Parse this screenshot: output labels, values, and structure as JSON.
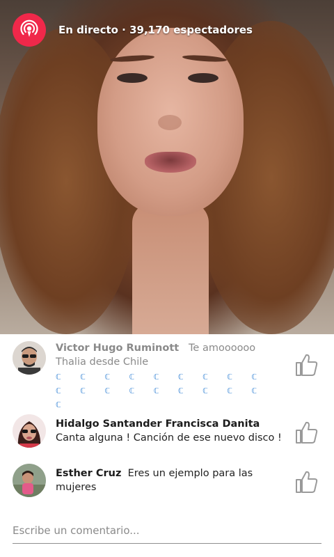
{
  "live": {
    "status_label": "En directo · 39,170 espectadores",
    "badge_color": "#f0284a"
  },
  "comments": [
    {
      "author": "Victor Hugo Ruminott",
      "message": "Te amoooooo Thalia desde Chile",
      "extra": "ℂ ℂ ℂ ℂ ℂ ℂ ℂ ℂ ℂ ℂ ℂ ℂ ℂ ℂ ℂ ℂ ℂ ℂ ℂ",
      "style": "muted",
      "avatar_icon": "avatar-man-sunglasses"
    },
    {
      "author": "Hidalgo Santander Francisca Danita",
      "message": "Canta alguna ! Canción de ese nuevo disco !",
      "style": "normal",
      "avatar_icon": "avatar-woman-sunglasses"
    },
    {
      "author": "Esther Cruz",
      "message": "Eres un ejemplo para las mujeres",
      "style": "normal",
      "avatar_icon": "avatar-child"
    }
  ],
  "composer": {
    "placeholder": "Escribe un comentario..."
  },
  "colors": {
    "accent": "#4a90d9",
    "like_icon": "#8a8a8a"
  }
}
